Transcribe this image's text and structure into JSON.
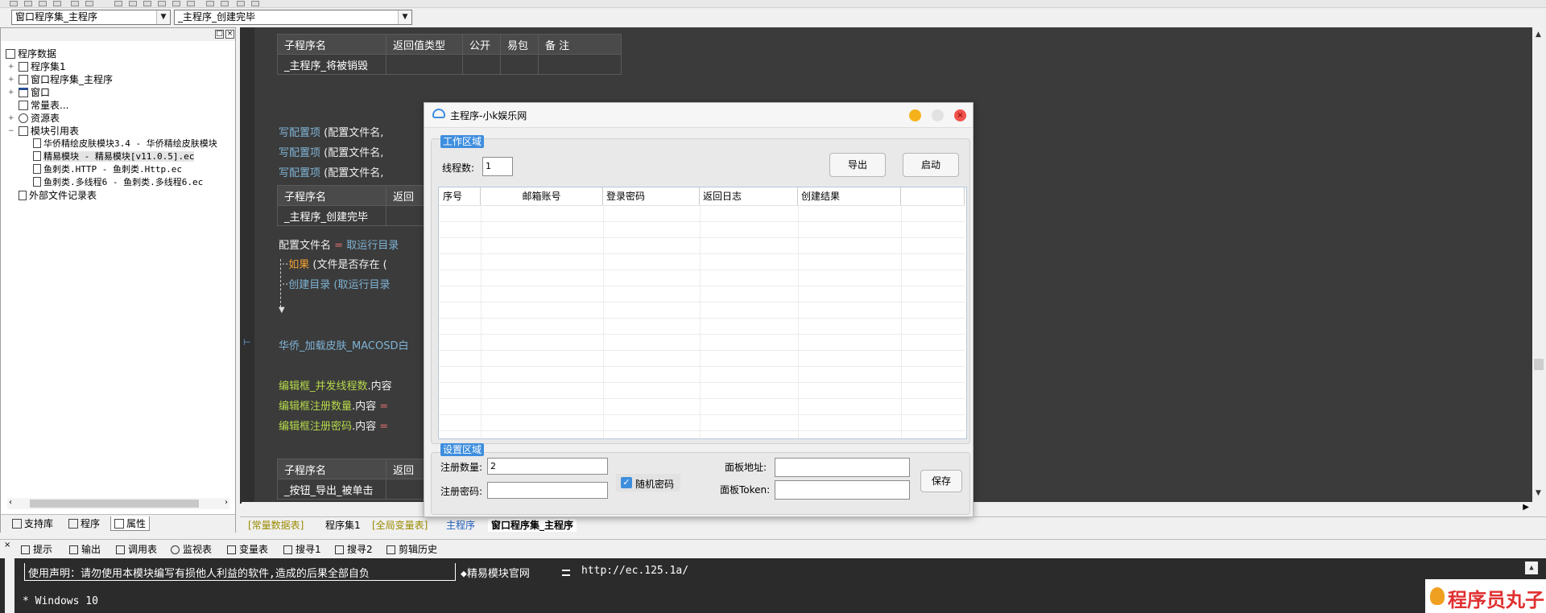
{
  "toolbar": {
    "combo_left": "窗口程序集_主程序",
    "combo_right": "_主程序_创建完毕"
  },
  "tree": {
    "root": "程序数据",
    "items": [
      {
        "label": "程序集1"
      },
      {
        "label": "窗口程序集_主程序"
      },
      {
        "label": "窗口"
      },
      {
        "label": "常量表..."
      },
      {
        "label": "资源表"
      },
      {
        "label": "模块引用表"
      }
    ],
    "modules": [
      "华侨精绘皮肤模块3.4 - 华侨精绘皮肤模块",
      "精易模块 - 精易模块[v11.0.5].ec",
      "鱼刺类.HTTP - 鱼刺类.Http.ec",
      "鱼刺类.多线程6 - 鱼刺类.多线程6.ec"
    ],
    "external": "外部文件记录表"
  },
  "left_tabs": [
    "支持库",
    "程序",
    "属性"
  ],
  "code": {
    "table1": {
      "headers": [
        "子程序名",
        "返回值类型",
        "公开",
        "易包",
        "备 注"
      ],
      "row": "_主程序_将被销毁"
    },
    "write_cfg_1": "写配置项",
    "write_cfg_args": "(配置文件名,",
    "table2": {
      "headers": [
        "子程序名",
        "返回"
      ],
      "row": "_主程序_创建完毕"
    },
    "cfg_line_a": "配置文件名",
    "cfg_line_eq": "=",
    "cfg_line_b": "取运行目录",
    "if_kw": "如果",
    "if_args": "(文件是否存在 (",
    "mkdir": "创建目录",
    "mkdir_args": "(取运行目录",
    "skin_call": "华侨_加载皮肤_MACOSD白",
    "edit1": "编辑框_并发线程数",
    "edit1_tail": ".内容",
    "edit2": "编辑框注册数量",
    "edit2_tail": ".内容",
    "edit3": "编辑框注册密码",
    "edit3_tail": ".内容",
    "eq": "=",
    "table3": {
      "headers": [
        "子程序名",
        "返回"
      ],
      "row": "_按钮_导出_被单击"
    }
  },
  "editor_tabs": [
    "[常量数据表]",
    "程序集1",
    "[全局变量表]",
    "主程序",
    "窗口程序集_主程序"
  ],
  "output_tabs": [
    "提示",
    "输出",
    "调用表",
    "监视表",
    "变量表",
    "搜寻1",
    "搜寻2",
    "剪辑历史"
  ],
  "output": {
    "line1": "使用声明：请勿使用本模块编写有损他人利益的软件,造成的后果全部自负",
    "line1_b": "◆精易模块官网",
    "line1_c": "http://ec.125.1a/",
    "line2": "* Windows 10"
  },
  "logo_text": "程序员丸子",
  "dialog": {
    "title": "主程序-小k娱乐网",
    "work_group": "工作区域",
    "threads_label": "线程数:",
    "threads_value": "1",
    "export_btn": "导出",
    "start_btn": "启动",
    "columns": [
      "序号",
      "邮箱账号",
      "登录密码",
      "返回日志",
      "创建结果"
    ],
    "settings_group": "设置区域",
    "reg_count_label": "注册数量:",
    "reg_count_value": "2",
    "reg_pwd_label": "注册密码:",
    "reg_pwd_value": "",
    "random_pwd_label": "随机密码",
    "random_pwd_checked": true,
    "panel_addr_label": "面板地址:",
    "panel_addr_value": "",
    "panel_token_label": "面板Token:",
    "panel_token_value": "",
    "save_btn": "保存"
  }
}
